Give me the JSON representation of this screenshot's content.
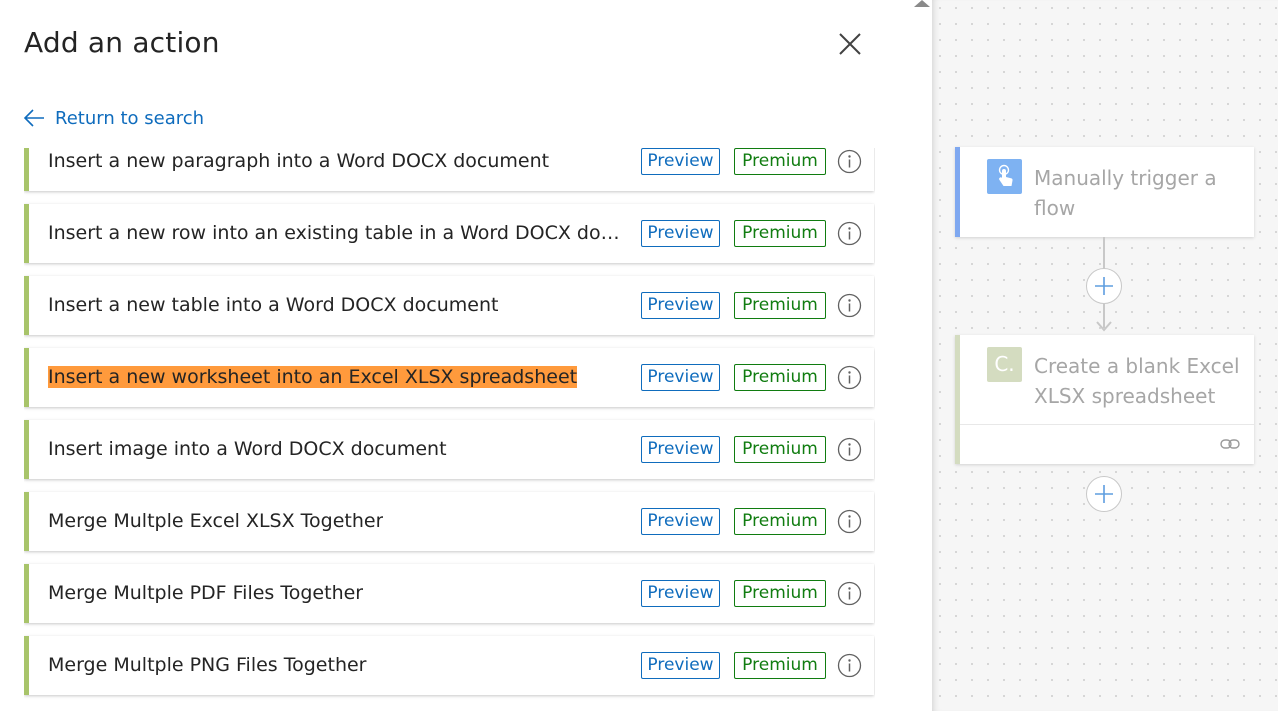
{
  "panel": {
    "title": "Add an action",
    "return_label": "Return to search",
    "badges": {
      "preview": "Preview",
      "premium": "Premium"
    },
    "actions": [
      {
        "label": "Insert a new paragraph into a Word DOCX document",
        "highlighted": false
      },
      {
        "label": "Insert a new row into an existing table in a Word DOCX docum...",
        "highlighted": false
      },
      {
        "label": "Insert a new table into a Word DOCX document",
        "highlighted": false
      },
      {
        "label": "Insert a new worksheet into an Excel XLSX spreadsheet",
        "highlighted": true
      },
      {
        "label": "Insert image into a Word DOCX document",
        "highlighted": false
      },
      {
        "label": "Merge Multple Excel XLSX Together",
        "highlighted": false
      },
      {
        "label": "Merge Multple PDF Files Together",
        "highlighted": false
      },
      {
        "label": "Merge Multple PNG Files Together",
        "highlighted": false
      }
    ]
  },
  "canvas": {
    "trigger_card": {
      "title": "Manually trigger a flow",
      "icon": "touch-hand-icon"
    },
    "excel_card": {
      "title": "Create a blank Excel XLSX spreadsheet",
      "icon_letter": "C.",
      "footer_icon": "link-icon"
    }
  },
  "colors": {
    "accent": "#0f6cbd",
    "premium": "#107c10",
    "row_border": "#a8c46a",
    "highlight": "#ff9a3c",
    "trigger_accent": "#7eb2f2"
  }
}
